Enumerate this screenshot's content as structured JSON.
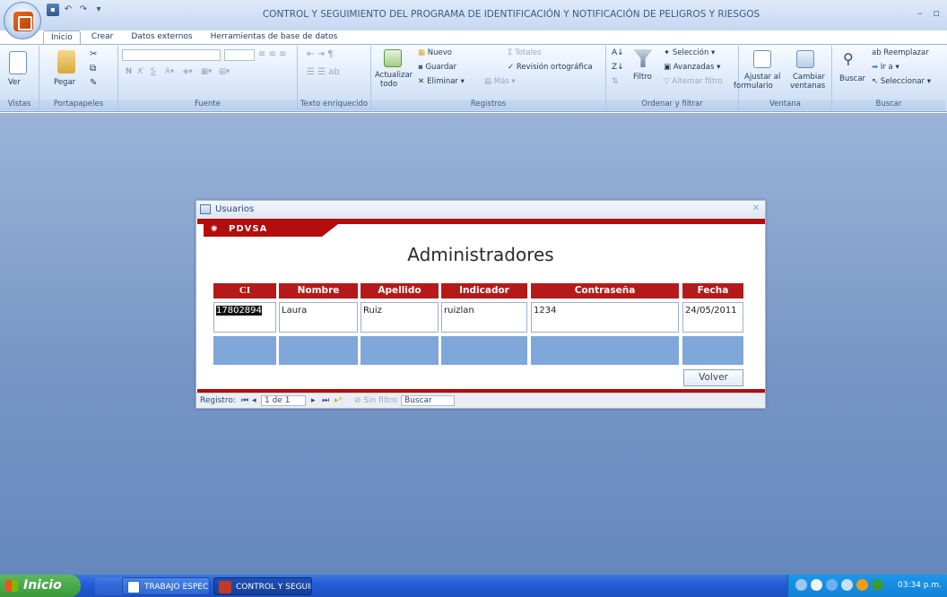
{
  "window": {
    "title": "CONTROL Y SEGUIMIENTO DEL PROGRAMA DE IDENTIFICACIÓN Y NOTIFICACIÓN DE PELIGROS Y RIESGOS"
  },
  "tabs": [
    {
      "label": "Inicio",
      "active": true
    },
    {
      "label": "Crear"
    },
    {
      "label": "Datos externos"
    },
    {
      "label": "Herramientas de base de datos"
    }
  ],
  "ribbon": {
    "vistas": {
      "ver": "Ver",
      "label": "Vistas"
    },
    "portapapeles": {
      "pegar": "Pegar",
      "label": "Portapapeles"
    },
    "fuente": {
      "label": "Fuente"
    },
    "texto": {
      "label": "Texto enriquecido"
    },
    "registros": {
      "actualizar": "Actualizar",
      "todo": "todo",
      "nuevo": "Nuevo",
      "guardar": "Guardar",
      "eliminar": "Eliminar",
      "totales": "Totales",
      "revision": "Revisión ortográfica",
      "mas": "Más",
      "label": "Registros"
    },
    "ordenar": {
      "filtro": "Filtro",
      "seleccion": "Selección",
      "avanzadas": "Avanzadas",
      "alternar": "Alternar filtro",
      "label": "Ordenar y filtrar"
    },
    "ventana": {
      "ajustar": "Ajustar al",
      "formulario": "formulario",
      "cambiar": "Cambiar",
      "ventanas": "ventanas",
      "label": "Ventana"
    },
    "buscar": {
      "buscar": "Buscar",
      "reemplazar": "Reemplazar",
      "ira": "Ir a",
      "seleccionar": "Seleccionar",
      "label": "Buscar"
    }
  },
  "form": {
    "window_title": "Usuarios",
    "logo": "PDVSA",
    "heading": "Administradores",
    "columns": [
      "CI",
      "Nombre",
      "Apellido",
      "Indicador",
      "Contraseña",
      "Fecha"
    ],
    "row": {
      "ci": "17802894",
      "nombre": "Laura",
      "apellido": "Ruiz",
      "indicador": "ruizlan",
      "contrasena": "1234",
      "fecha": "24/05/2011"
    },
    "volver": "Volver",
    "nav": {
      "registro": "Registro:",
      "position": "1 de 1",
      "sin_filtro": "Sin filtro",
      "buscar": "Buscar"
    }
  },
  "taskbar": {
    "start": "Inicio",
    "items": [
      "TRABAJO ESPECIAL ...",
      "CONTROL Y SEGUIMI..."
    ],
    "clock": "03:34 p.m."
  },
  "colors": {
    "accent_red": "#b51a1a",
    "grid_blue": "#7fa7d9",
    "workspace": "#7796c6"
  }
}
